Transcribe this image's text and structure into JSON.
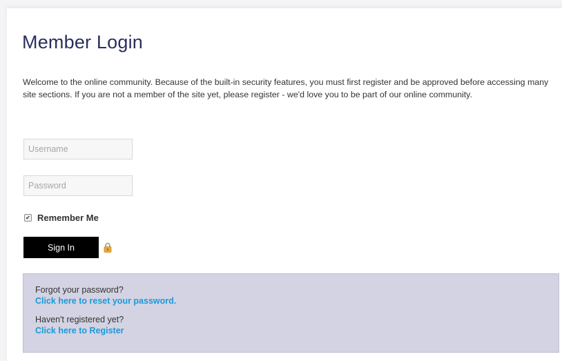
{
  "login": {
    "title": "Member Login",
    "intro": "Welcome to the online community. Because of the built-in security features, you must first register and be approved before accessing many site sections. If you are not a member of the site yet, please register - we'd love you to be part of our online community.",
    "username_placeholder": "Username",
    "username_value": "",
    "password_placeholder": "Password",
    "password_value": "",
    "remember_label": "Remember Me",
    "remember_checked": true,
    "signin_label": "Sign In",
    "lock_icon": "lock-icon"
  },
  "help": {
    "forgot_question": "Forgot your password?",
    "forgot_link": "Click here to reset your password.",
    "register_question": "Haven't registered yet?",
    "register_link": "Click here to Register"
  },
  "colors": {
    "title": "#2a2f5c",
    "button_bg": "#000000",
    "help_bg": "#d3d3e3",
    "link": "#1a9ad9",
    "lock": "#e8a93a"
  }
}
